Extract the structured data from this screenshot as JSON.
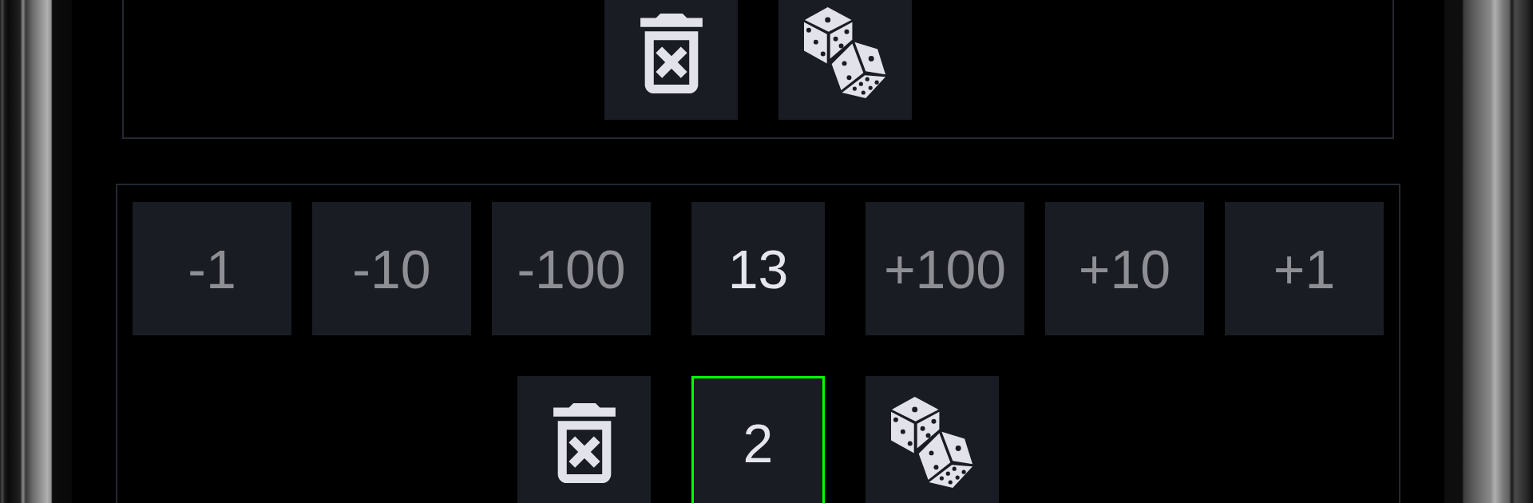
{
  "top_panel": {
    "buttons": [
      {
        "kind": "clear"
      },
      {
        "kind": "roll"
      }
    ]
  },
  "bottom_panel": {
    "adjust_row": [
      {
        "kind": "step",
        "label": "-1"
      },
      {
        "kind": "step",
        "label": "-10"
      },
      {
        "kind": "step",
        "label": "-100"
      },
      {
        "kind": "value",
        "label": "13",
        "selected": false
      },
      {
        "kind": "step",
        "label": "+100"
      },
      {
        "kind": "step",
        "label": "+10"
      },
      {
        "kind": "step",
        "label": "+1"
      }
    ],
    "action_row": [
      {
        "kind": "clear"
      },
      {
        "kind": "value",
        "label": "2",
        "selected": true
      },
      {
        "kind": "roll"
      }
    ]
  }
}
